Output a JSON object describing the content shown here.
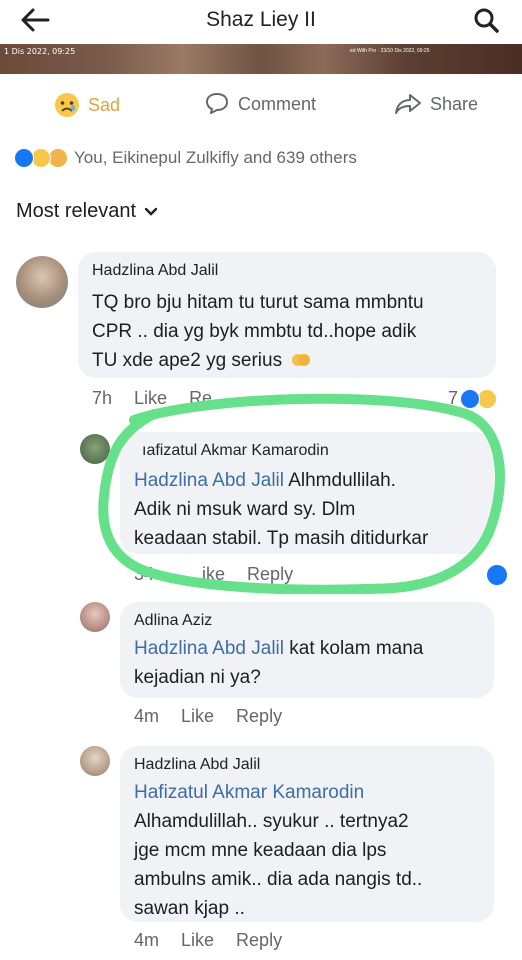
{
  "header": {
    "title": "Shaz Liey II"
  },
  "photo": {
    "stamp_left": "1 Dis 2022, 09:25",
    "stamp_right": "ed With Pro · 23/10 Dis 2022, 09:25"
  },
  "actions": {
    "sad": "Sad",
    "comment": "Comment",
    "share": "Share"
  },
  "reactions": {
    "summary": "You, Eikinepul Zulkifly and 639 others"
  },
  "sort": {
    "label": "Most relevant"
  },
  "comments": [
    {
      "name": "Hadzlina Abd Jalil",
      "lines": [
        "TQ bro bju hitam tu turut sama mmbntu",
        "CPR .. dia yg byk mmbtu td..hope adik",
        "TU xde ape2 yg serius"
      ],
      "time": "7h",
      "like": "Like",
      "reply": "Re",
      "reaction_count": "7"
    },
    {
      "name": "ıafizatul Akmar Kamarodin",
      "mention": "Hadzlina Abd Jalil",
      "first_rest": " Alhmdullilah.",
      "lines": [
        "Adik ni msuk ward sy. Dlm",
        "keadaan stabil. Tp masih ditidurkar"
      ],
      "time": "34",
      "like": "ike",
      "reply": "Reply"
    },
    {
      "name": "Adlina Aziz",
      "mention": "Hadzlina Abd Jalil",
      "first_rest": " kat kolam mana",
      "lines": [
        "kejadian ni ya?"
      ],
      "time": "4m",
      "like": "Like",
      "reply": "Reply"
    },
    {
      "name": "Hadzlina Abd Jalil",
      "mention": "Hafizatul Akmar Kamarodin",
      "lines": [
        "Alhamdulillah.. syukur .. tertnya2",
        "jge mcm mne keadaan dia lps",
        "ambulns amik.. dia ada nangis td..",
        "sawan kjap .."
      ],
      "time": "4m",
      "like": "Like",
      "reply": "Reply"
    }
  ],
  "colors": {
    "link": "#3b6ea5",
    "highlight": "#66e08a",
    "meta": "#65676b",
    "bubble": "#f0f2f5"
  }
}
